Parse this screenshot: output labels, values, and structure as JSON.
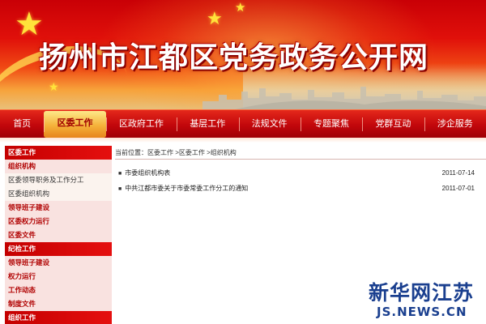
{
  "banner": {
    "title": "扬州市江都区党务政务公开网"
  },
  "nav": {
    "items": [
      {
        "label": "首页"
      },
      {
        "label": "区委工作",
        "active": true
      },
      {
        "label": "区政府工作"
      },
      {
        "label": "基层工作"
      },
      {
        "label": "法规文件"
      },
      {
        "label": "专题聚焦"
      },
      {
        "label": "党群互动"
      },
      {
        "label": "涉企服务"
      }
    ]
  },
  "sidebar": {
    "items": [
      {
        "label": "区委工作",
        "style": "header"
      },
      {
        "label": "组织机构",
        "style": "pink"
      },
      {
        "label": "区委领导职务及工作分工",
        "style": "sub"
      },
      {
        "label": "区委组织机构",
        "style": "sub"
      },
      {
        "label": "领导班子建设",
        "style": "pink"
      },
      {
        "label": "区委权力运行",
        "style": "pink"
      },
      {
        "label": "区委文件",
        "style": "pink"
      },
      {
        "label": "纪检工作",
        "style": "header"
      },
      {
        "label": "领导班子建设",
        "style": "pink"
      },
      {
        "label": "权力运行",
        "style": "pink"
      },
      {
        "label": "工作动态",
        "style": "pink"
      },
      {
        "label": "制度文件",
        "style": "pink"
      },
      {
        "label": "组织工作",
        "style": "header"
      }
    ]
  },
  "breadcrumb": {
    "text": "当前位置：区委工作 >区委工作 >组织机构"
  },
  "articles": [
    {
      "bullet": "■",
      "title": "市委组织机构表",
      "date": "2011-07-14"
    },
    {
      "bullet": "■",
      "title": "中共江都市委关于市委常委工作分工的通知",
      "date": "2011-07-01"
    }
  ],
  "watermark": {
    "logo": "新华网江苏",
    "url": "JS.NEWS.CN"
  }
}
